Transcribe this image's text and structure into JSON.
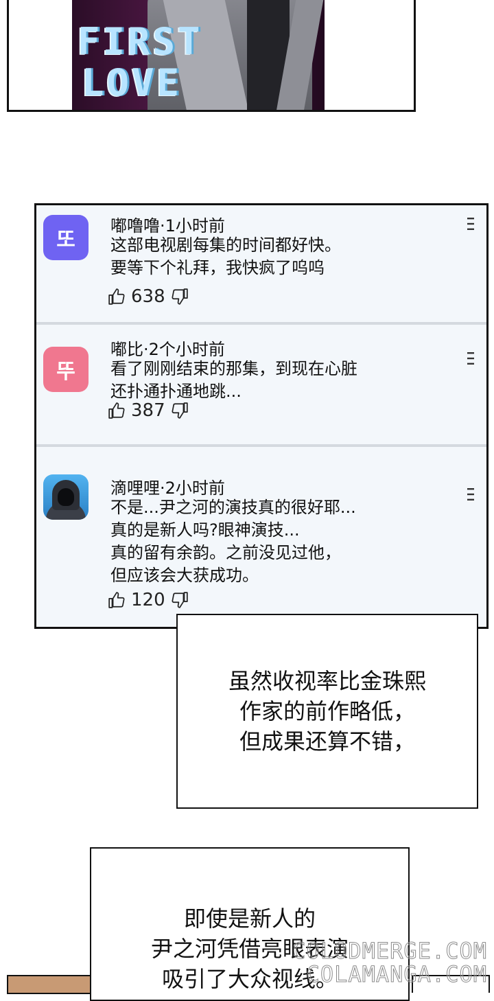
{
  "poster": {
    "title_line1": "FIRST",
    "title_line2": "LOVE"
  },
  "comments": [
    {
      "avatar_text": "또",
      "meta": "嘟噜噜·1小时前",
      "text": "这部电视剧每集的时间都好快。\n要等下个礼拜，我快疯了呜呜",
      "likes": "638"
    },
    {
      "avatar_text": "뚜",
      "meta": "嘟比·2个小时前",
      "text": "看了刚刚结束的那集，到现在心脏\n还扑通扑通地跳...",
      "likes": "387"
    },
    {
      "avatar_text": "",
      "avatar_icon": "hooded-person-icon",
      "meta": "滴哩哩·2小时前",
      "text": "不是...尹之河的演技真的很好耶...\n真的是新人吗?眼神演技...\n真的留有余韵。之前没见过他，\n但应该会大获成功。",
      "likes": "120"
    }
  ],
  "narration": {
    "box1": "虽然收视率比金珠熙\n作家的前作略低，\n但成果还算不错，",
    "box2": "即使是新人的\n尹之河凭借亮眼表演\n吸引了大众视线。"
  },
  "watermark": {
    "line1": "COLODMERGE.COM",
    "line2": "COLAMANGA.COM"
  },
  "colors": {
    "avatar1": "#6f63f2",
    "avatar2": "#f0778f",
    "card_bg": "#f3f7fb"
  }
}
